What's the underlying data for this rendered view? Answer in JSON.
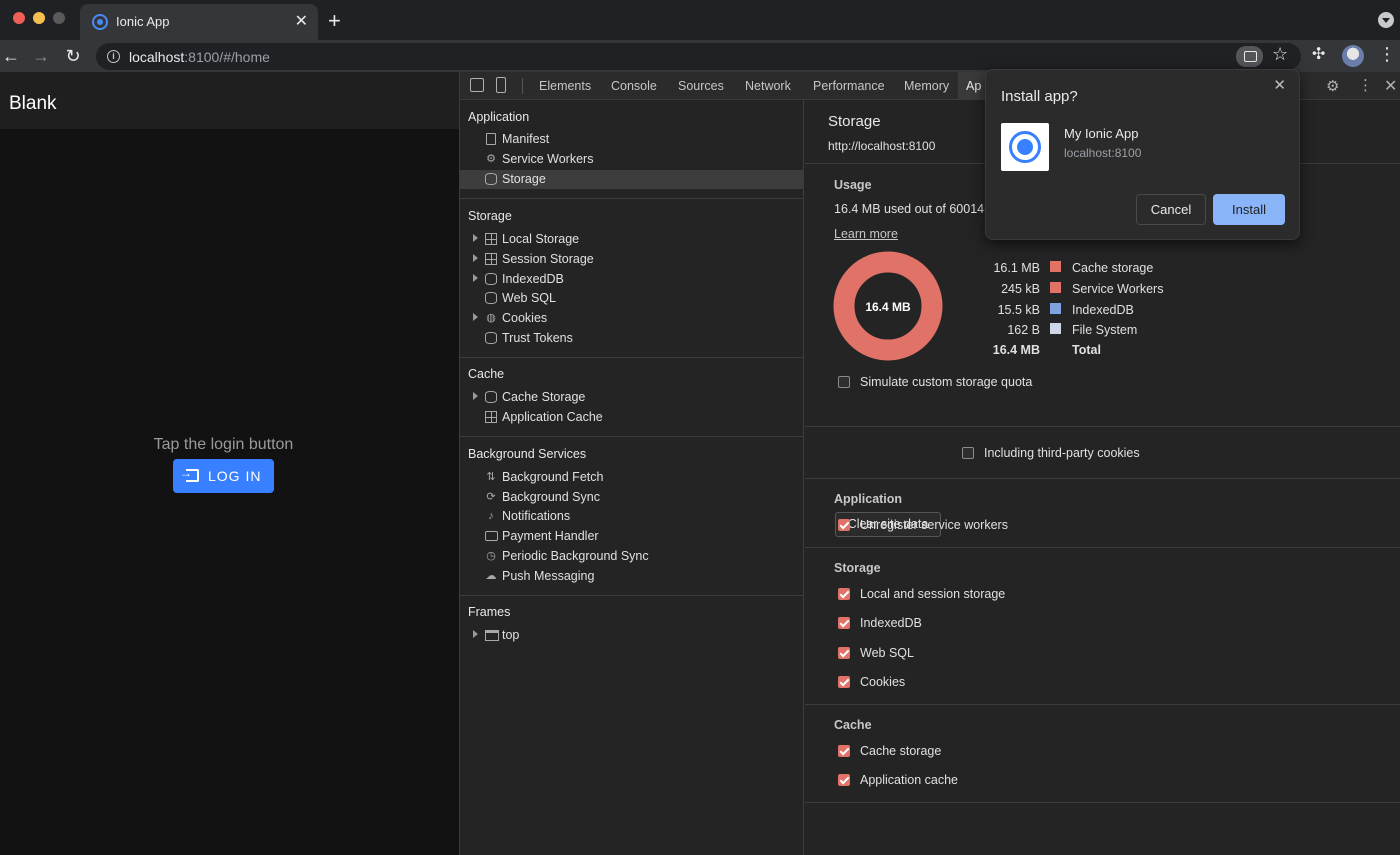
{
  "browser": {
    "tab_title": "Ionic App",
    "url_host": "localhost",
    "url_rest": ":8100/#/home"
  },
  "app": {
    "title": "Blank",
    "hint": "Tap the login button",
    "login_label": "LOG IN"
  },
  "devtools": {
    "tabs": [
      "Elements",
      "Console",
      "Sources",
      "Network",
      "Performance",
      "Memory",
      "Ap"
    ],
    "sidebar": {
      "application_title": "Application",
      "application_items": [
        "Manifest",
        "Service Workers",
        "Storage"
      ],
      "storage_title": "Storage",
      "storage_items": [
        "Local Storage",
        "Session Storage",
        "IndexedDB",
        "Web SQL",
        "Cookies",
        "Trust Tokens"
      ],
      "cache_title": "Cache",
      "cache_items": [
        "Cache Storage",
        "Application Cache"
      ],
      "bg_title": "Background Services",
      "bg_items": [
        "Background Fetch",
        "Background Sync",
        "Notifications",
        "Payment Handler",
        "Periodic Background Sync",
        "Push Messaging"
      ],
      "frames_title": "Frames",
      "frames_items": [
        "top"
      ]
    },
    "main": {
      "title": "Storage",
      "origin": "http://localhost:8100",
      "usage_title": "Usage",
      "usage_text": "16.4 MB used out of 600145",
      "learn_more": "Learn more",
      "donut_label": "16.4 MB",
      "legend": [
        {
          "value": "16.1 MB",
          "name": "Cache storage",
          "color": "#e07267"
        },
        {
          "value": "245 kB",
          "name": "Service Workers",
          "color": "#e07267"
        },
        {
          "value": "15.5 kB",
          "name": "IndexedDB",
          "color": "#7fa3e0"
        },
        {
          "value": "162 B",
          "name": "File System",
          "color": "#cfd6e8"
        },
        {
          "value": "16.4 MB",
          "name": "Total",
          "color": ""
        }
      ],
      "simulate_quota": "Simulate custom storage quota",
      "clear_button": "Clear site data",
      "third_party": "Including third-party cookies",
      "app_section": "Application",
      "app_checks": [
        "Unregister service workers"
      ],
      "storage_section": "Storage",
      "storage_checks": [
        "Local and session storage",
        "IndexedDB",
        "Web SQL",
        "Cookies"
      ],
      "cache_section": "Cache",
      "cache_checks": [
        "Cache storage",
        "Application cache"
      ]
    }
  },
  "popup": {
    "title": "Install app?",
    "app_name": "My Ionic App",
    "app_host": "localhost:8100",
    "cancel": "Cancel",
    "install": "Install"
  },
  "colors": {
    "accent": "#3880ff",
    "donut": "#e07267",
    "install": "#8ab4f8"
  }
}
